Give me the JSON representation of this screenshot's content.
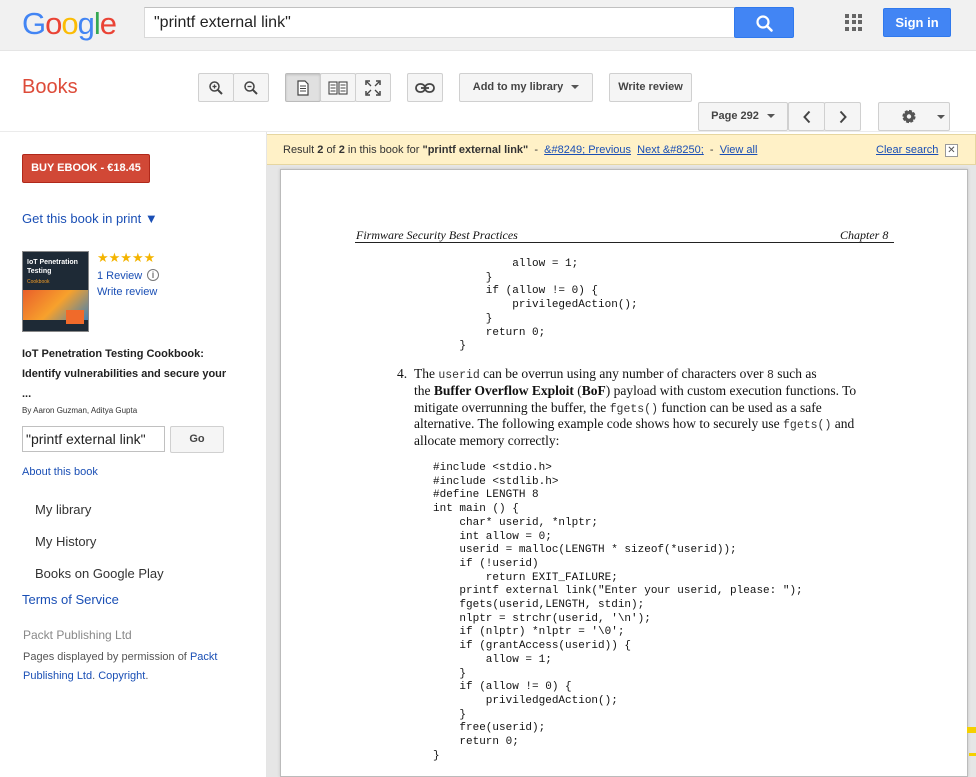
{
  "header": {
    "logo": "Google",
    "search_value": "\"printf external link\"",
    "signin_label": "Sign in"
  },
  "toolbar": {
    "section_title": "Books",
    "add_library_label": "Add to my library",
    "write_review_label": "Write review",
    "page_label": "Page 292"
  },
  "sidebar": {
    "buy_label": "BUY EBOOK - €18.45",
    "get_print_label": "Get this book in print ▼",
    "cover_title": "IoT Penetration Testing",
    "cover_subtitle": "Cookbook",
    "stars": "★★★★★",
    "review_count": "1 Review",
    "write_review_link": "Write review",
    "book_title": "IoT Penetration Testing Cookbook: Identify vulnerabilities and secure your ...",
    "authors": "By Aaron Guzman, Aditya Gupta",
    "search_value": "\"printf external link\"",
    "go_label": "Go",
    "about_link": "About this book",
    "links": [
      "My library",
      "My History",
      "Books on Google Play"
    ],
    "terms_label": "Terms of Service",
    "publisher": "Packt Publishing Ltd",
    "permission_prefix": "Pages displayed by permission of",
    "permission_link": "Packt Publishing Ltd",
    "copyright_link": "Copyright"
  },
  "result_bar": {
    "prefix": "Result",
    "current": "2",
    "of_word": "of",
    "total": "2",
    "middle": "in this book for",
    "query": "\"printf external link\"",
    "previous_link": "&#8249; Previous",
    "next_link": "Next &#8250;",
    "view_all_link": "View all",
    "clear_search_label": "Clear search"
  },
  "page": {
    "header_left": "Firmware Security Best Practices",
    "header_right": "Chapter 8",
    "code_top": "            allow = 1;\n        }\n        if (allow != 0) {\n            privilegedAction();\n        }\n        return 0;\n    }",
    "item_number": "4.",
    "para_lines": [
      [
        "The ",
        "userid",
        " can be overrun using any number of characters over ",
        "8",
        " such as"
      ],
      [
        "the ",
        "Buffer Overflow Exploit",
        " (",
        "BoF",
        ") payload with custom execution functions. To"
      ],
      [
        "mitigate overrunning the buffer, the ",
        "fgets()",
        " function can be used as a safe"
      ],
      [
        "alternative. The following example code shows how to securely use ",
        "fgets()",
        " and"
      ],
      [
        "allocate memory correctly:"
      ]
    ],
    "code_bottom": "#include <stdio.h>\n#include <stdlib.h>\n#define LENGTH 8\nint main () {\n    char* userid, *nlptr;\n    int allow = 0;\n    userid = malloc(LENGTH * sizeof(*userid));\n    if (!userid)\n        return EXIT_FAILURE;\n    printf external link(\"Enter your userid, please: \");\n    fgets(userid,LENGTH, stdin);\n    nlptr = strchr(userid, '\\n');\n    if (nlptr) *nlptr = '\\0';\n    if (grantAccess(userid)) {\n        allow = 1;\n    }\n    if (allow != 0) {\n        priviledgedAction();\n    }\n    free(userid);\n    return 0;\n}"
  },
  "colors": {
    "brand_blue": "#4285f4",
    "books_red": "#dd4b39",
    "buy_red": "#d14836",
    "link_blue": "#1a4fb5",
    "result_bar_bg": "#fff1c7"
  }
}
